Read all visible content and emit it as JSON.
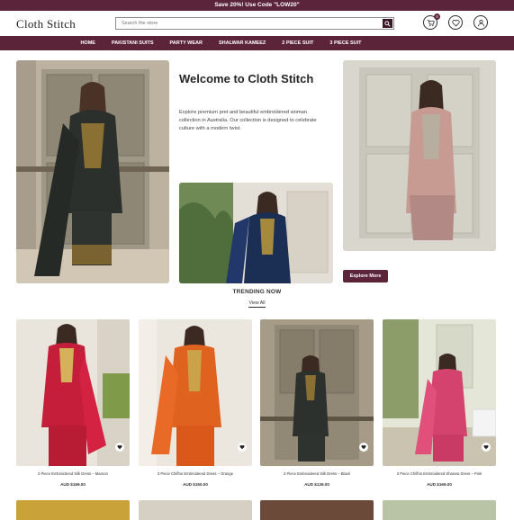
{
  "announcement": "Save 20%! Use Code \"LOW20\"",
  "header": {
    "logo": "Cloth Stitch",
    "search_placeholder": "Search the store",
    "cart_count": "0",
    "icons": [
      "cart-icon",
      "heart-icon",
      "user-icon"
    ]
  },
  "nav": [
    "HOME",
    "PAKISTANI SUITS",
    "PARTY WEAR",
    "SHALWAR KAMEEZ",
    "2 PIECE SUIT",
    "3 PIECE SUIT"
  ],
  "hero": {
    "title": "Welcome to Cloth Stitch",
    "text": "Explore premium pret and beautiful embroidered woman collection in Australia. Our collection is designed to celebrate culture with a modern twist.",
    "button": "Explore More"
  },
  "trending": {
    "title": "TRENDING NOW",
    "view_all": "View All",
    "products": [
      {
        "name": "3 Piece Embroidered Silk Dress – Maroon",
        "price": "AUD $169.00"
      },
      {
        "name": "3 Piece Chiffon Embroidered Dress – Orange",
        "price": "AUD $150.00"
      },
      {
        "name": "3 Piece Embroidered Silk Dress – Black",
        "price": "AUD $139.00"
      },
      {
        "name": "3 Piece Chiffon Embroidered Sharara Dress – Pink",
        "price": "AUD $169.00"
      }
    ]
  },
  "colors": {
    "brand": "#5b2438",
    "accent": "#3a1626"
  }
}
